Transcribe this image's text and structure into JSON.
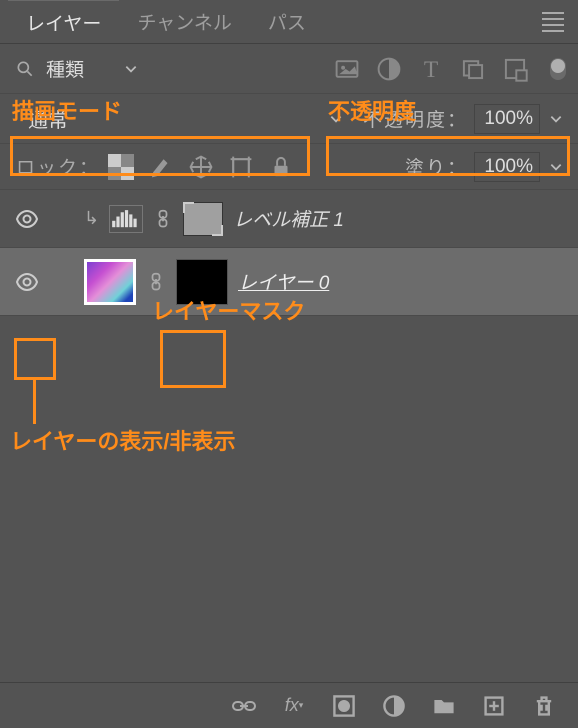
{
  "tabs": {
    "layers": "レイヤー",
    "channels": "チャンネル",
    "paths": "パス"
  },
  "filter": {
    "kind_label": "種類"
  },
  "blend": {
    "mode": "通常",
    "opacity_label": "不透明度：",
    "opacity_value": "100%"
  },
  "lock": {
    "label": "ロック：",
    "fill_label": "塗り：",
    "fill_value": "100%"
  },
  "layers_list": {
    "adj_name": "レベル補正 1",
    "layer0_name": "レイヤー 0"
  },
  "annotations": {
    "blend_mode": "描画モード",
    "opacity": "不透明度",
    "layer_mask": "レイヤーマスク",
    "visibility": "レイヤーの表示/非表示"
  }
}
